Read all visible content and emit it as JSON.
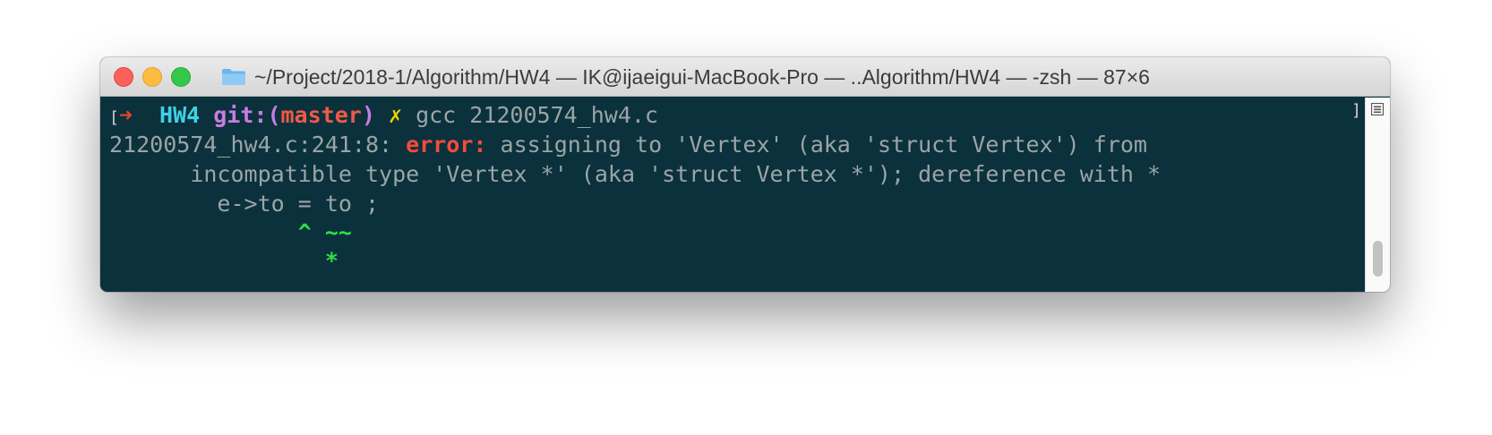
{
  "window": {
    "title": "~/Project/2018-1/Algorithm/HW4 — IK@ijaeigui-MacBook-Pro — ..Algorithm/HW4 — -zsh — 87×6"
  },
  "colors": {
    "terminal_background": "#0b313d",
    "prompt_arrow": "#e4442b",
    "prompt_dir": "#3fd1e6",
    "git_label": "#c77de4",
    "branch": "#f05a46",
    "dirty_mark": "#ecd400",
    "error": "#f54b3c",
    "caret": "#2fdf45",
    "text": "#9aa5a6"
  },
  "icons": {
    "close": "close-button",
    "minimize": "minimize-button",
    "zoom": "zoom-button",
    "folder": "folder-icon",
    "scroll_menu": "list-icon"
  },
  "terminal": {
    "line1": {
      "left_marker": "[",
      "arrow": "➜",
      "dir": "HW4",
      "git_prefix": "git:(",
      "branch": "master",
      "git_suffix": ")",
      "dirty": "✗",
      "command": "gcc 21200574_hw4.c",
      "right_marker": "]"
    },
    "line2": {
      "location": "21200574_hw4.c:241:8:",
      "error_label": "error:",
      "message": "assigning to 'Vertex' (aka 'struct Vertex') from"
    },
    "line3": "incompatible type 'Vertex *' (aka 'struct Vertex *'); dereference with *",
    "line4": "e->to = to ;",
    "line5": "^ ~~",
    "line6": "*"
  }
}
